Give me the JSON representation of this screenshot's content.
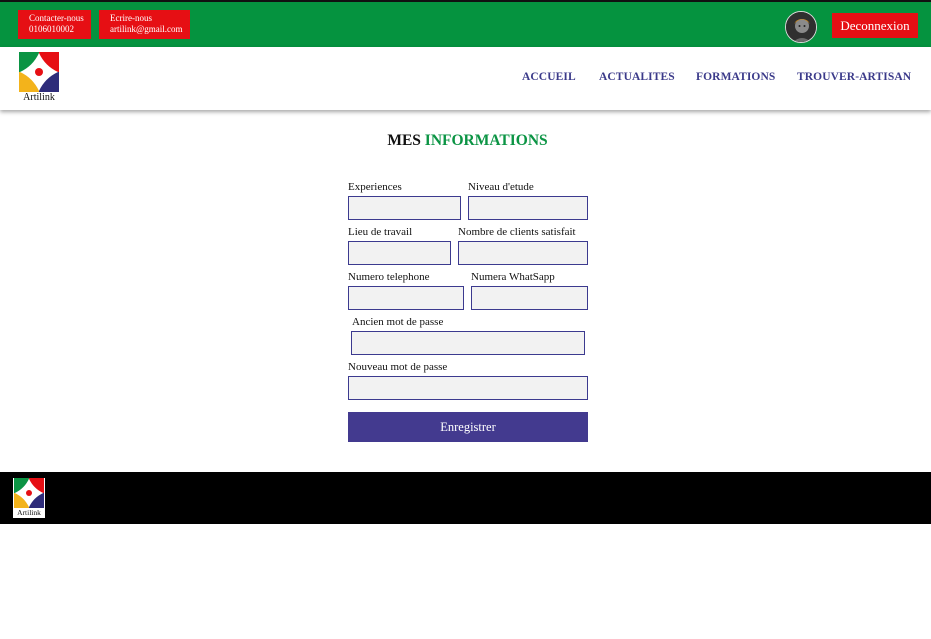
{
  "topbar": {
    "contacts": [
      {
        "label": "Contacter-nous",
        "value": "0106010002"
      },
      {
        "label": "Ecrire-nous",
        "value": "artilink@gmail.com"
      }
    ],
    "logout_label": "Deconnexion",
    "colors": {
      "bar": "#05933f",
      "contact_bg": "#e60f14",
      "logout_bg": "#e60f14"
    }
  },
  "header": {
    "logo_text": "Artilink",
    "nav": [
      {
        "label": "ACCUEIL"
      },
      {
        "label": "ACTUALITES"
      },
      {
        "label": "FORMATIONS"
      },
      {
        "label": "TROUVER-ARTISAN"
      }
    ],
    "nav_color": "#3b3a8a"
  },
  "form": {
    "title_part1": "MES",
    "title_part2": "INFORMATIONS",
    "fields": {
      "experiences": {
        "label": "Experiences",
        "value": ""
      },
      "niveau": {
        "label": "Niveau d'etude",
        "value": ""
      },
      "lieu": {
        "label": "Lieu de travail",
        "value": ""
      },
      "clients": {
        "label": "Nombre de clients satisfait",
        "value": ""
      },
      "telephone": {
        "label": "Numero telephone",
        "value": ""
      },
      "whatsapp": {
        "label": "Numera WhatSapp",
        "value": ""
      },
      "ancien_mdp": {
        "label": "Ancien mot de passe",
        "value": ""
      },
      "nouveau_mdp": {
        "label": "Nouveau mot de passe",
        "value": ""
      }
    },
    "submit_label": "Enregistrer",
    "colors": {
      "accent": "#0b9444",
      "button": "#433a8f",
      "input_border": "#3c3a8f"
    }
  },
  "footer": {
    "logo_text": "Artilink",
    "background": "#000000"
  },
  "icons": {
    "avatar": "user-avatar-icon",
    "logo": "artilink-diamond-icon"
  }
}
